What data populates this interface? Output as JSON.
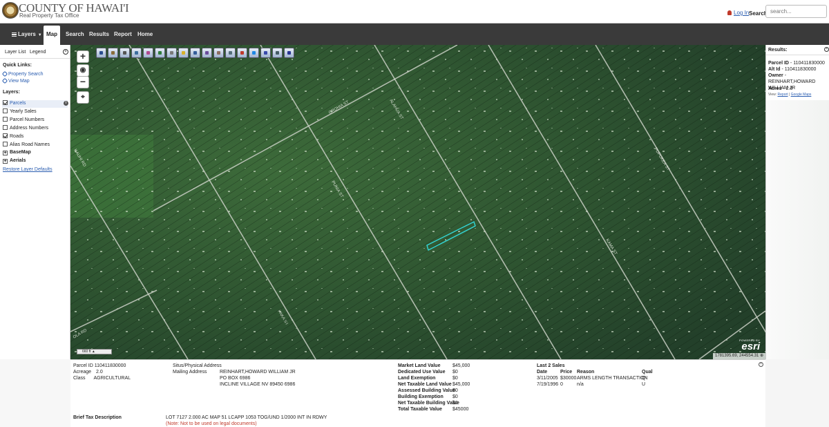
{
  "header": {
    "brand_title": "COUNTY OF HAWAI'I",
    "brand_subtitle": "Real Property Tax Office",
    "login_label": "Log In",
    "search_label": "Search",
    "search_placeholder": "search..."
  },
  "nav": {
    "items": [
      {
        "label": "Layers",
        "icon": "menu-icon"
      },
      {
        "label": "Map",
        "active": true
      },
      {
        "label": "Search"
      },
      {
        "label": "Results"
      },
      {
        "label": "Report"
      },
      {
        "label": "Home"
      }
    ]
  },
  "sidebar": {
    "tabs": [
      "Layer List",
      "Legend"
    ],
    "quick_links_heading": "Quick Links:",
    "quick_links": [
      "Property Search",
      "View Map"
    ],
    "layers_heading": "Layers:",
    "layers": [
      {
        "label": "Parcels",
        "checked": true,
        "highlighted": true,
        "info": true
      },
      {
        "label": "Yearly Sales",
        "checked": false
      },
      {
        "label": "Parcel Numbers",
        "checked": false
      },
      {
        "label": "Address Numbers",
        "checked": false
      },
      {
        "label": "Roads",
        "checked": true
      },
      {
        "label": "Alias Road Names",
        "checked": false
      },
      {
        "label": "BaseMap",
        "group": true
      },
      {
        "label": "Aerials",
        "group": true
      }
    ],
    "restore_label": "Restore Layer Defaults"
  },
  "map": {
    "scale_label": "660 ft",
    "coordinates": "1781395.69, 244554.31",
    "esri_powered": "POWERED BY",
    "esri_logo": "esri",
    "toolbar_icons": [
      "identify-icon",
      "flag-icon",
      "find-icon",
      "parcel-icon",
      "erase-icon",
      "measure-icon",
      "tool-icon",
      "bulb-icon",
      "layers-icon",
      "buffer-icon",
      "people-icon",
      "zoom-select-icon",
      "pencil-icon",
      "extent-icon",
      "share-icon",
      "print-icon",
      "save-icon"
    ],
    "accent_highlight": "#33d6d6"
  },
  "results": {
    "title": "Results:",
    "parcel_id_label": "Parcel ID",
    "parcel_id": "- 110411830000",
    "alt_id_label": "Alt Id",
    "alt_id": "- 110411830000",
    "owner_label": "Owner",
    "owner": "- REINHART,HOWARD WILLIAM JR",
    "acres_label": "Acres",
    "acres": "- 2.0",
    "view_label": "View:",
    "view_report": "Report",
    "view_sep": "|",
    "view_google": "Google Maps"
  },
  "details": {
    "parcel_id_label": "Parcel ID",
    "parcel_id": "110411830000",
    "acreage_label": "Acreage",
    "acreage": "2.0",
    "class_label": "Class",
    "class_value": "AGRICULTURAL",
    "situs_label": "Situs/Physical Address",
    "mailing_label": "Mailing Address",
    "mailing_lines": [
      "REINHART,HOWARD WILLIAM JR",
      "PO BOX 6986",
      "INCLINE VILLAGE NV 89450 6986"
    ],
    "values": [
      {
        "label": "Market Land Value",
        "value": "$45,000"
      },
      {
        "label": "Dedicated Use Value",
        "value": "$0"
      },
      {
        "label": "Land Exemption",
        "value": "$0"
      },
      {
        "label": "Net Taxable Land Value",
        "value": "$45,000"
      },
      {
        "label": "Assessed Building Value",
        "value": "$0"
      },
      {
        "label": "Building Exemption",
        "value": "$0"
      },
      {
        "label": "Net Taxable Building Value",
        "value": "$0"
      },
      {
        "label": "Total Taxable Value",
        "value": "$45000"
      }
    ],
    "sales_heading": "Last 2 Sales",
    "sales_columns": [
      "Date",
      "Price",
      "Reason",
      "Qual"
    ],
    "sales_rows": [
      [
        "3/11/2005",
        "$30000",
        "ARMS LENGTH TRANSACTION",
        "Q"
      ],
      [
        "7/19/1996",
        "0",
        "n/a",
        "U"
      ]
    ],
    "brief_label": "Brief Tax Description",
    "brief_value": "LOT 7127 2.000 AC MAP 51 LCAPP 1053 TOG/UND 1/2000 INT IN RDWY",
    "note": "(Note: Not to be used on legal documents)"
  }
}
